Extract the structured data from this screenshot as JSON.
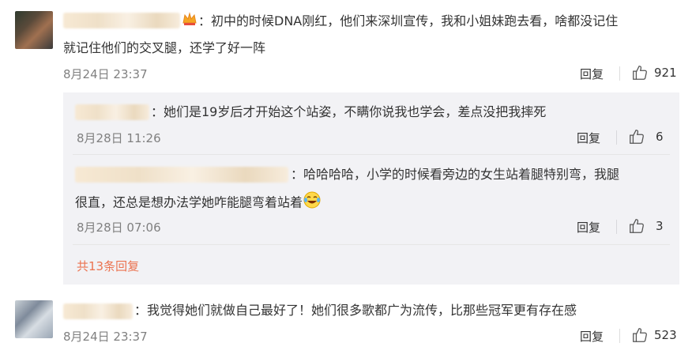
{
  "comments": [
    {
      "text": "：初中的时候DNA刚红，他们来深圳宣传，我和小姐妹跑去看，啥都没记住",
      "text_line2": "就记住他们的交叉腿，还学了好一阵",
      "time": "8月24日 23:37",
      "reply_label": "回复",
      "likes": "921"
    },
    {
      "text": "：我觉得她们就做自己最好了！她们很多歌都广为流传，比那些冠军更有存在感",
      "time": "8月24日 23:37",
      "reply_label": "回复",
      "likes": "523"
    }
  ],
  "replies": [
    {
      "text": "：她们是19岁后才开始这个站姿，不瞒你说我也学会，差点没把我摔死",
      "time": "8月28日 11:26",
      "reply_label": "回复",
      "likes": "6"
    },
    {
      "text": "：哈哈哈哈，小学的时候看旁边的女生站着腿特别弯，我腿",
      "text_line2": "很直，还总是想办法学她咋能腿弯着站着",
      "time": "8月28日 07:06",
      "reply_label": "回复",
      "likes": "3"
    }
  ],
  "more_replies": "共13条回复",
  "icons": {
    "like": "thumbs-up-icon",
    "crown": "crown-badge-icon",
    "laugh": "laugh-cry-emoji-icon"
  },
  "colors": {
    "link": "#eb7350",
    "reply_bg": "#f2f2f5",
    "meta": "#808080"
  }
}
